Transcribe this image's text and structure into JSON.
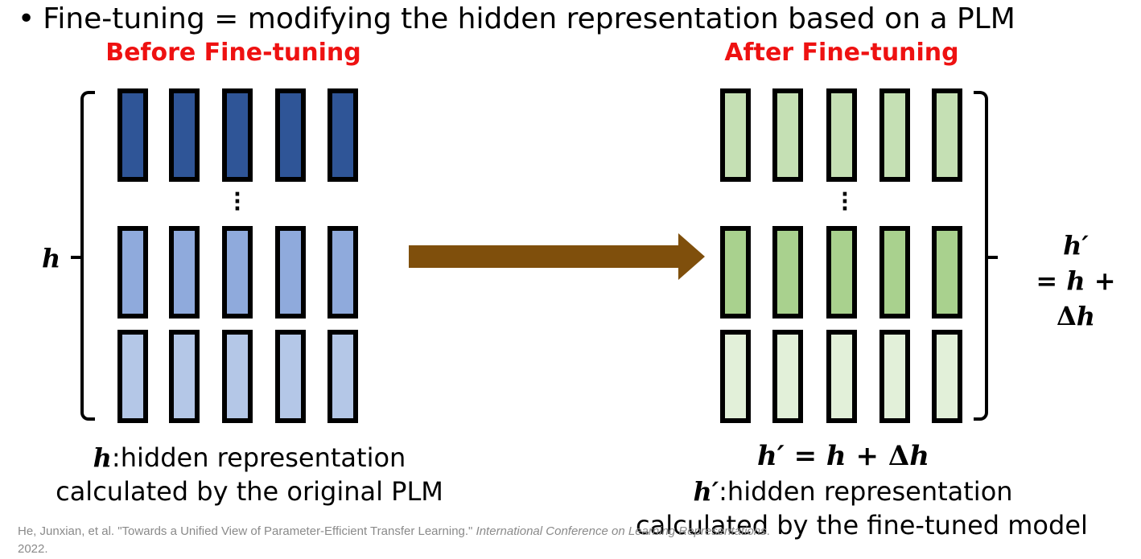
{
  "title": "Fine-tuning = modifying the hidden representation based on a PLM",
  "left_heading": "Before Fine-tuning",
  "right_heading": "After Fine-tuning",
  "left_label": {
    "var": "h"
  },
  "right_label": {
    "line1": "h′",
    "line2_eq": "=",
    "line2_var": "h",
    "line2_op": "+",
    "line2_delta": "Δ",
    "line2_var2": "h"
  },
  "left_caption": {
    "var": "h",
    "line1": ":hidden representation",
    "line2": "calculated by the original PLM"
  },
  "right_caption": {
    "eq_lhs": "h′",
    "eq_equals": "=",
    "eq_var": "h",
    "eq_plus": "+",
    "eq_delta": "Δ",
    "eq_var2": "h",
    "var": "h′",
    "line1": ":hidden representation",
    "line2": "calculated by the fine-tuned model"
  },
  "citation": {
    "authors_title": "He, Junxian, et al. \"Towards a Unified View of Parameter-Efficient Transfer Learning.\"",
    "venue_part1": "International Conference on",
    "venue_part2": "Learning Representations",
    "year": ". 2022."
  },
  "colors": {
    "heading": "#ee1111",
    "left_dark": "#2f5597",
    "left_mid": "#8faadc",
    "left_light": "#b4c7e7",
    "right_top": "#c5e0b4",
    "right_mid": "#a9d18e",
    "right_light": "#e2f0d9",
    "arrow": "#7f4f0c"
  }
}
